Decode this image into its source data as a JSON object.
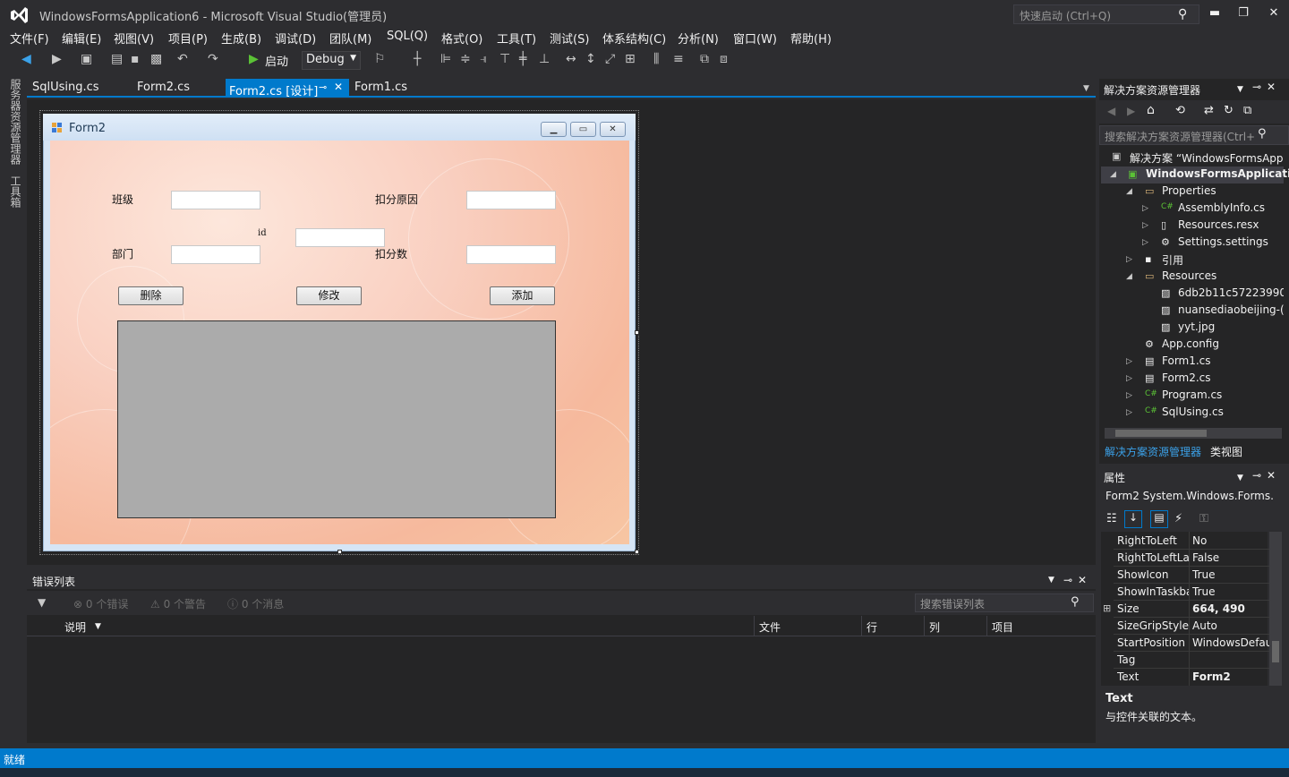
{
  "window": {
    "title": "WindowsFormsApplication6 - Microsoft Visual Studio(管理员)",
    "quick_launch_placeholder": "快速启动 (Ctrl+Q)",
    "minimize": "▬",
    "restore": "❐",
    "close": "✕"
  },
  "menu": [
    "文件(F)",
    "编辑(E)",
    "视图(V)",
    "项目(P)",
    "生成(B)",
    "调试(D)",
    "团队(M)",
    "SQL(Q)",
    "格式(O)",
    "工具(T)",
    "测试(S)",
    "体系结构(C)",
    "分析(N)",
    "窗口(W)",
    "帮助(H)"
  ],
  "toolbar": {
    "start_label": "启动",
    "config": "Debug"
  },
  "left_strip": {
    "server_explorer": "服务器资源管理器",
    "toolbox": "工具箱"
  },
  "doc_tabs": {
    "tab1": "SqlUsing.cs",
    "tab2": "Form2.cs",
    "tab3": "Form2.cs [设计]",
    "tab4": "Form1.cs"
  },
  "form": {
    "caption": "Form2",
    "labels": {
      "class": "班级",
      "dept": "部门",
      "id": "id",
      "reason": "扣分原因",
      "points": "扣分数"
    },
    "buttons": {
      "delete": "删除",
      "edit": "修改",
      "add": "添加"
    }
  },
  "error_list": {
    "title": "错误列表",
    "errors": "0 个错误",
    "warnings": "0 个警告",
    "messages": "0 个消息",
    "search_placeholder": "搜索错误列表",
    "columns": {
      "desc": "说明",
      "file": "文件",
      "line": "行",
      "col": "列",
      "project": "项目"
    }
  },
  "solution_explorer": {
    "title": "解决方案资源管理器",
    "search_placeholder": "搜索解决方案资源管理器(Ctrl+",
    "items": [
      {
        "label": "解决方案 “WindowsFormsApp"
      },
      {
        "label": "WindowsFormsApplicatio"
      },
      {
        "label": "Properties"
      },
      {
        "label": "AssemblyInfo.cs"
      },
      {
        "label": "Resources.resx"
      },
      {
        "label": "Settings.settings"
      },
      {
        "label": "引用"
      },
      {
        "label": "Resources"
      },
      {
        "label": "6db2b11c57223990"
      },
      {
        "label": "nuansediaobeijing-("
      },
      {
        "label": "yyt.jpg"
      },
      {
        "label": "App.config"
      },
      {
        "label": "Form1.cs"
      },
      {
        "label": "Form2.cs"
      },
      {
        "label": "Program.cs"
      },
      {
        "label": "SqlUsing.cs"
      }
    ],
    "tab_solution": "解决方案资源管理器",
    "tab_class": "类视图"
  },
  "properties": {
    "title": "属性",
    "object": "Form2  System.Windows.Forms.",
    "rows": [
      {
        "name": "RightToLeft",
        "value": "No"
      },
      {
        "name": "RightToLeftLa",
        "value": "False"
      },
      {
        "name": "ShowIcon",
        "value": "True"
      },
      {
        "name": "ShowInTaskba",
        "value": "True"
      },
      {
        "name": "Size",
        "value": "664, 490"
      },
      {
        "name": "SizeGripStyle",
        "value": "Auto"
      },
      {
        "name": "StartPosition",
        "value": "WindowsDefau"
      },
      {
        "name": "Tag",
        "value": ""
      },
      {
        "name": "Text",
        "value": "Form2"
      }
    ],
    "desc_name": "Text",
    "desc_text": "与控件关联的文本。"
  },
  "status": {
    "text": "就绪"
  },
  "colors": {
    "accent": "#007acc",
    "background": "#2d2d30"
  }
}
